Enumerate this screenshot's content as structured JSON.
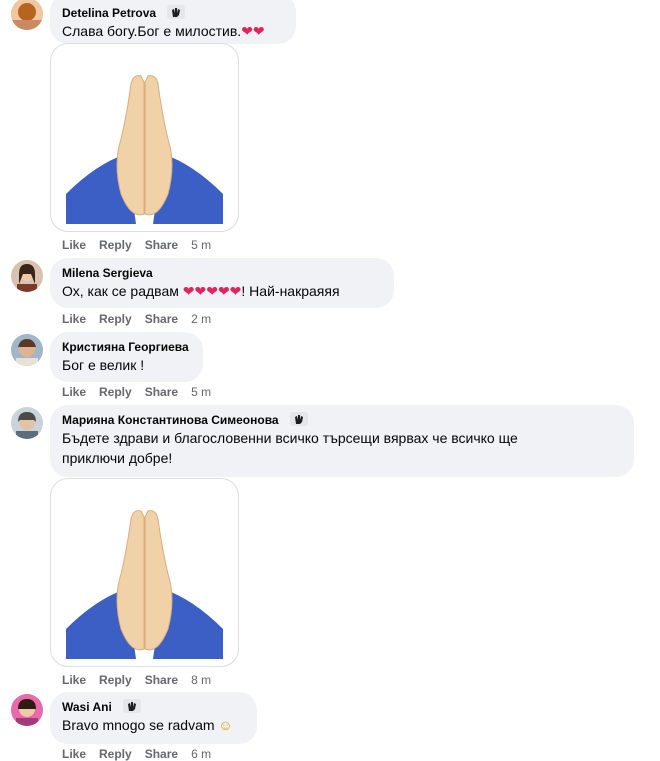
{
  "comments": [
    {
      "name": "Detelina Petrova",
      "text": "Слава богу.Бог е милостив.",
      "hearts": "❤❤",
      "actions": {
        "like": "Like",
        "reply": "Reply",
        "share": "Share",
        "time": "5 m"
      }
    },
    {
      "name": "Milena Sergieva",
      "text_before": "Ох, как се радвам ",
      "hearts": "❤❤❤❤❤",
      "text_after": "! Най-накраяяя",
      "actions": {
        "like": "Like",
        "reply": "Reply",
        "share": "Share",
        "time": "2 m"
      }
    },
    {
      "name": "Кристияна Георгиева",
      "text": "Бог е велик !",
      "actions": {
        "like": "Like",
        "reply": "Reply",
        "share": "Share",
        "time": "5 m"
      }
    },
    {
      "name": "Марияна Константинова Симеонова",
      "text_line1": "Бъдете здрави и благословенни всичко търсещи вярвах че всичко ще",
      "text_line2": "приключи добре!",
      "actions": {
        "like": "Like",
        "reply": "Reply",
        "share": "Share",
        "time": "8 m"
      }
    },
    {
      "name": "Wasi Ani",
      "text": "Bravo mnogo se radvam",
      "emoji": "☺",
      "actions": {
        "like": "Like",
        "reply": "Reply",
        "share": "Share",
        "time": "6 m"
      }
    }
  ],
  "colors": {
    "bubble": "#f0f2f5",
    "meta": "#65676b",
    "heart": "#e0245e"
  },
  "icons": {
    "badge": "wave-hand-icon",
    "sticker": "folded-hands-icon"
  }
}
